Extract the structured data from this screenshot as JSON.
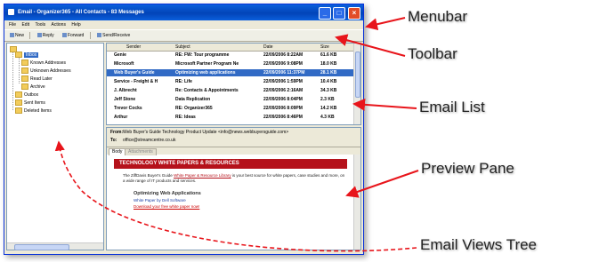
{
  "window": {
    "title": "Email - Organizer365 - All Contacts - 83 Messages",
    "buttons": {
      "minimize": "_",
      "maximize": "□",
      "close": "×"
    }
  },
  "menubar": {
    "items": [
      "File",
      "Edit",
      "Tools",
      "Actions",
      "Help"
    ]
  },
  "toolbar": {
    "items": [
      {
        "label": "New",
        "icon": "new-icon"
      },
      {
        "label": "Reply",
        "icon": "reply-icon"
      },
      {
        "label": "Forward",
        "icon": "forward-icon"
      },
      {
        "label": "Send/Receive",
        "icon": "send-receive-icon"
      }
    ]
  },
  "tree": {
    "items": [
      "Inbox",
      "Known Addresses",
      "Unknown Addresses",
      "Read Later",
      "Archive",
      "Outbox",
      "Sent Items",
      "Deleted Items"
    ]
  },
  "email_list": {
    "columns": [
      "Sender",
      "Subject",
      "Date",
      "Size"
    ],
    "rows": [
      {
        "sender": "Genie",
        "subject": "RE: FW: Tour programme",
        "date": "22/09/2006 8:22AM",
        "size": "61.6 KB"
      },
      {
        "sender": "Microsoft",
        "subject": "Microsoft Partner Program Ne",
        "date": "22/09/2006 9:08PM",
        "size": "18.0 KB"
      },
      {
        "sender": "Web Buyer's Guide",
        "subject": "Optimizing web applications",
        "date": "22/09/2006 11:37PM",
        "size": "28.1 KB"
      },
      {
        "sender": "Service - Freight & H",
        "subject": "RE: Life",
        "date": "22/09/2006 1:59PM",
        "size": "10.4 KB"
      },
      {
        "sender": "J. Albrecht",
        "subject": "Re: Contacts & Appointments",
        "date": "22/09/2006 2:16AM",
        "size": "34.3 KB"
      },
      {
        "sender": "Jeff Stone",
        "subject": "Data Replication",
        "date": "22/09/2006 8:04PM",
        "size": "2.3 KB"
      },
      {
        "sender": "Trevor Cocks",
        "subject": "RE: Organizer365",
        "date": "22/09/2006 8:09PM",
        "size": "14.2 KB"
      },
      {
        "sender": "Arthur",
        "subject": "RE: Ideas",
        "date": "22/09/2006 8:46PM",
        "size": "4.3 KB"
      }
    ]
  },
  "preview": {
    "from_label": "From:",
    "from_value": "Web Buyer's Guide Technology Product Update <info@news.webbuyersguide.com>",
    "to_label": "To:",
    "to_value": "office@streamcentre.co.uk",
    "tabs": [
      "Body",
      "Attachments"
    ],
    "banner": "TECHNOLOGY WHITE PAPERS & RESOURCES",
    "para_start": "The ZiffDavis Buyer's Guide",
    "para_link": "White Paper & Resource Library",
    "para_end": "is your best source for white papers, case studies and more, on a wide range of IT products and services.",
    "sub_heading": "Optimizing Web Applications",
    "sub_line": "White Paper by Dell Software",
    "download_link": "Download your free white paper now!"
  },
  "callouts": {
    "menubar": "Menubar",
    "toolbar": "Toolbar",
    "email_list": "Email List",
    "preview_pane": "Preview Pane",
    "email_views_tree": "Email Views Tree"
  },
  "colors": {
    "arrow": "#e8151b",
    "selection": "#316ac5",
    "titlebar": "#0a5fdc",
    "banner": "#b5121b"
  }
}
